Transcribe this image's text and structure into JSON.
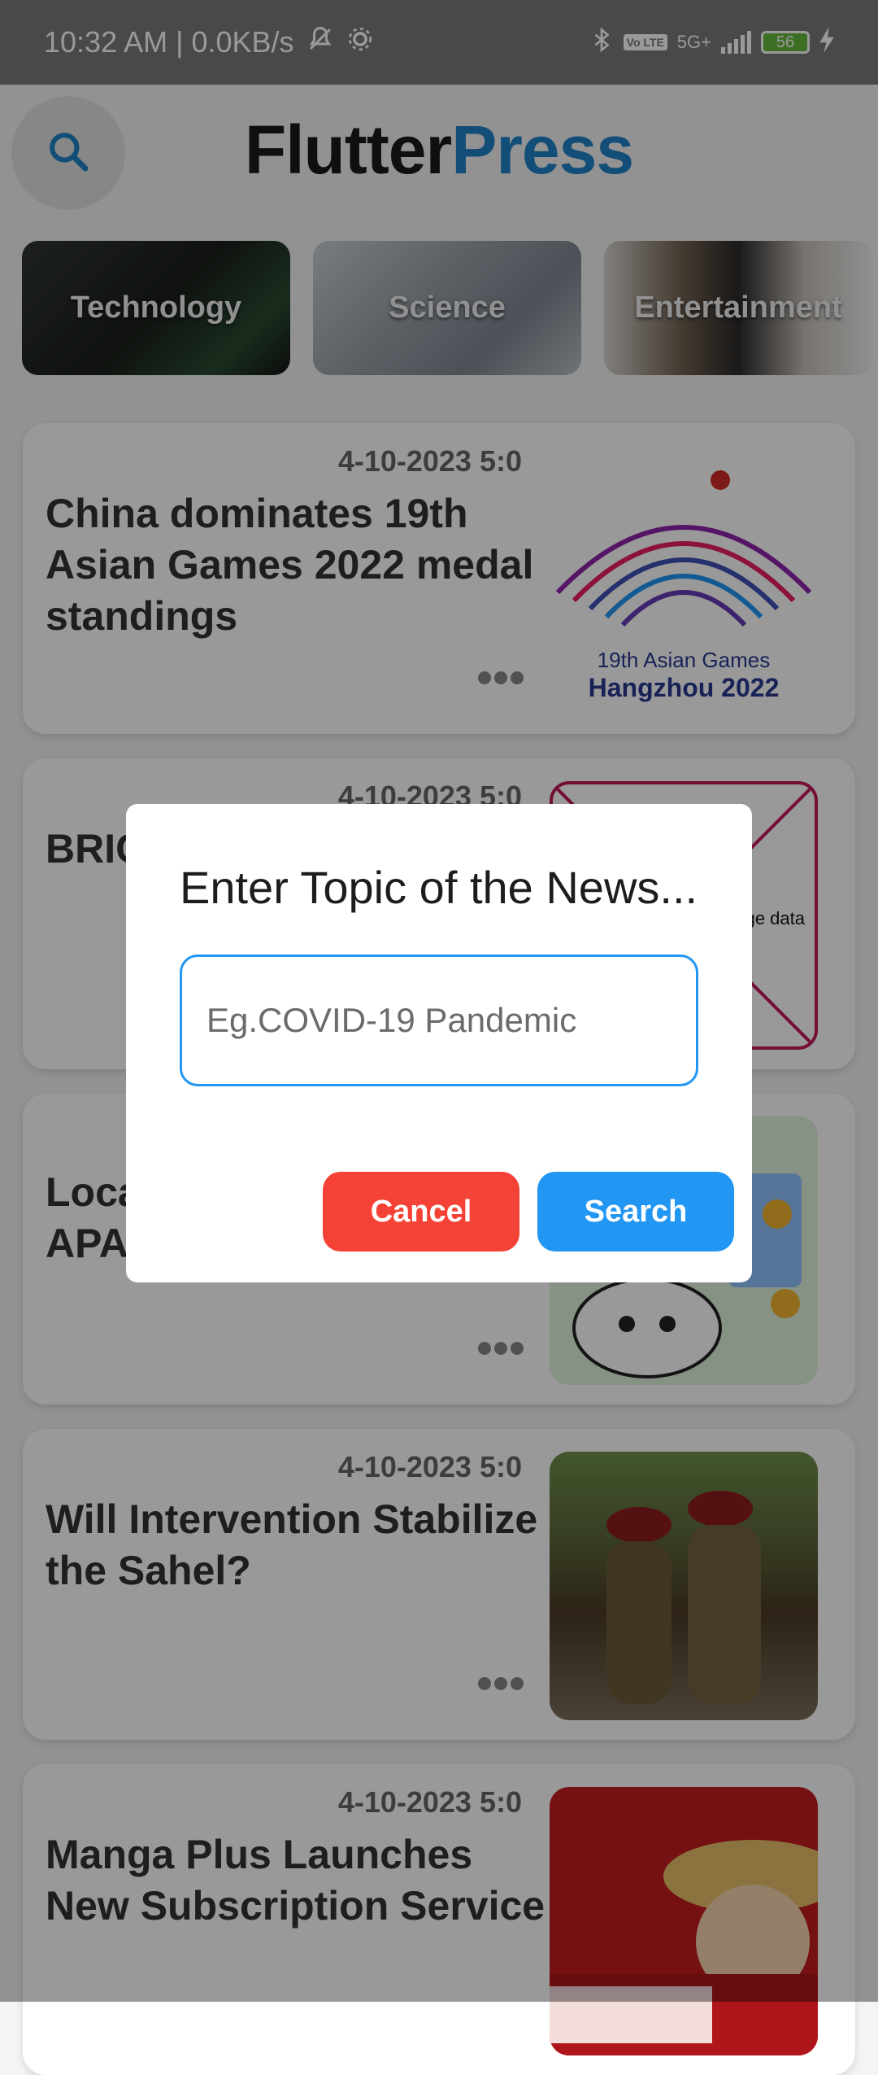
{
  "status_bar": {
    "time_info": "10:32 AM | 0.0KB/s",
    "network": "5G+",
    "volte": "Vo LTE",
    "battery": "56"
  },
  "header": {
    "title_part1": "Flutter",
    "title_part2": "Press",
    "search_icon": "search-icon",
    "colors": {
      "accent": "#1f83c8",
      "dark": "#1a1a1a"
    }
  },
  "categories": [
    {
      "label": "Technology"
    },
    {
      "label": "Science"
    },
    {
      "label": "Entertainment"
    }
  ],
  "articles": [
    {
      "date": "4-10-2023 5:0",
      "title": "China dominates 19th Asian Games 2022 medal standings",
      "thumb_caption": "19th Asian Games",
      "thumb_caption2": "Hangzhou 2022"
    },
    {
      "date": "4-10-2023 5:0",
      "title": "BRICS Impe Sub-",
      "thumb_caption": "ge data"
    },
    {
      "date": "",
      "title": "Loca thriv emerging APAC markets"
    },
    {
      "date": "4-10-2023 5:0",
      "title": "Will Intervention Stabilize the Sahel?"
    },
    {
      "date": "4-10-2023 5:0",
      "title": "Manga Plus Launches New Subscription Service"
    }
  ],
  "dialog": {
    "title": "Enter Topic of the News...",
    "input_placeholder": "Eg.COVID-19 Pandemic",
    "input_value": "",
    "cancel_label": "Cancel",
    "search_label": "Search",
    "colors": {
      "cancel": "#f44336",
      "search": "#2196f3"
    }
  }
}
